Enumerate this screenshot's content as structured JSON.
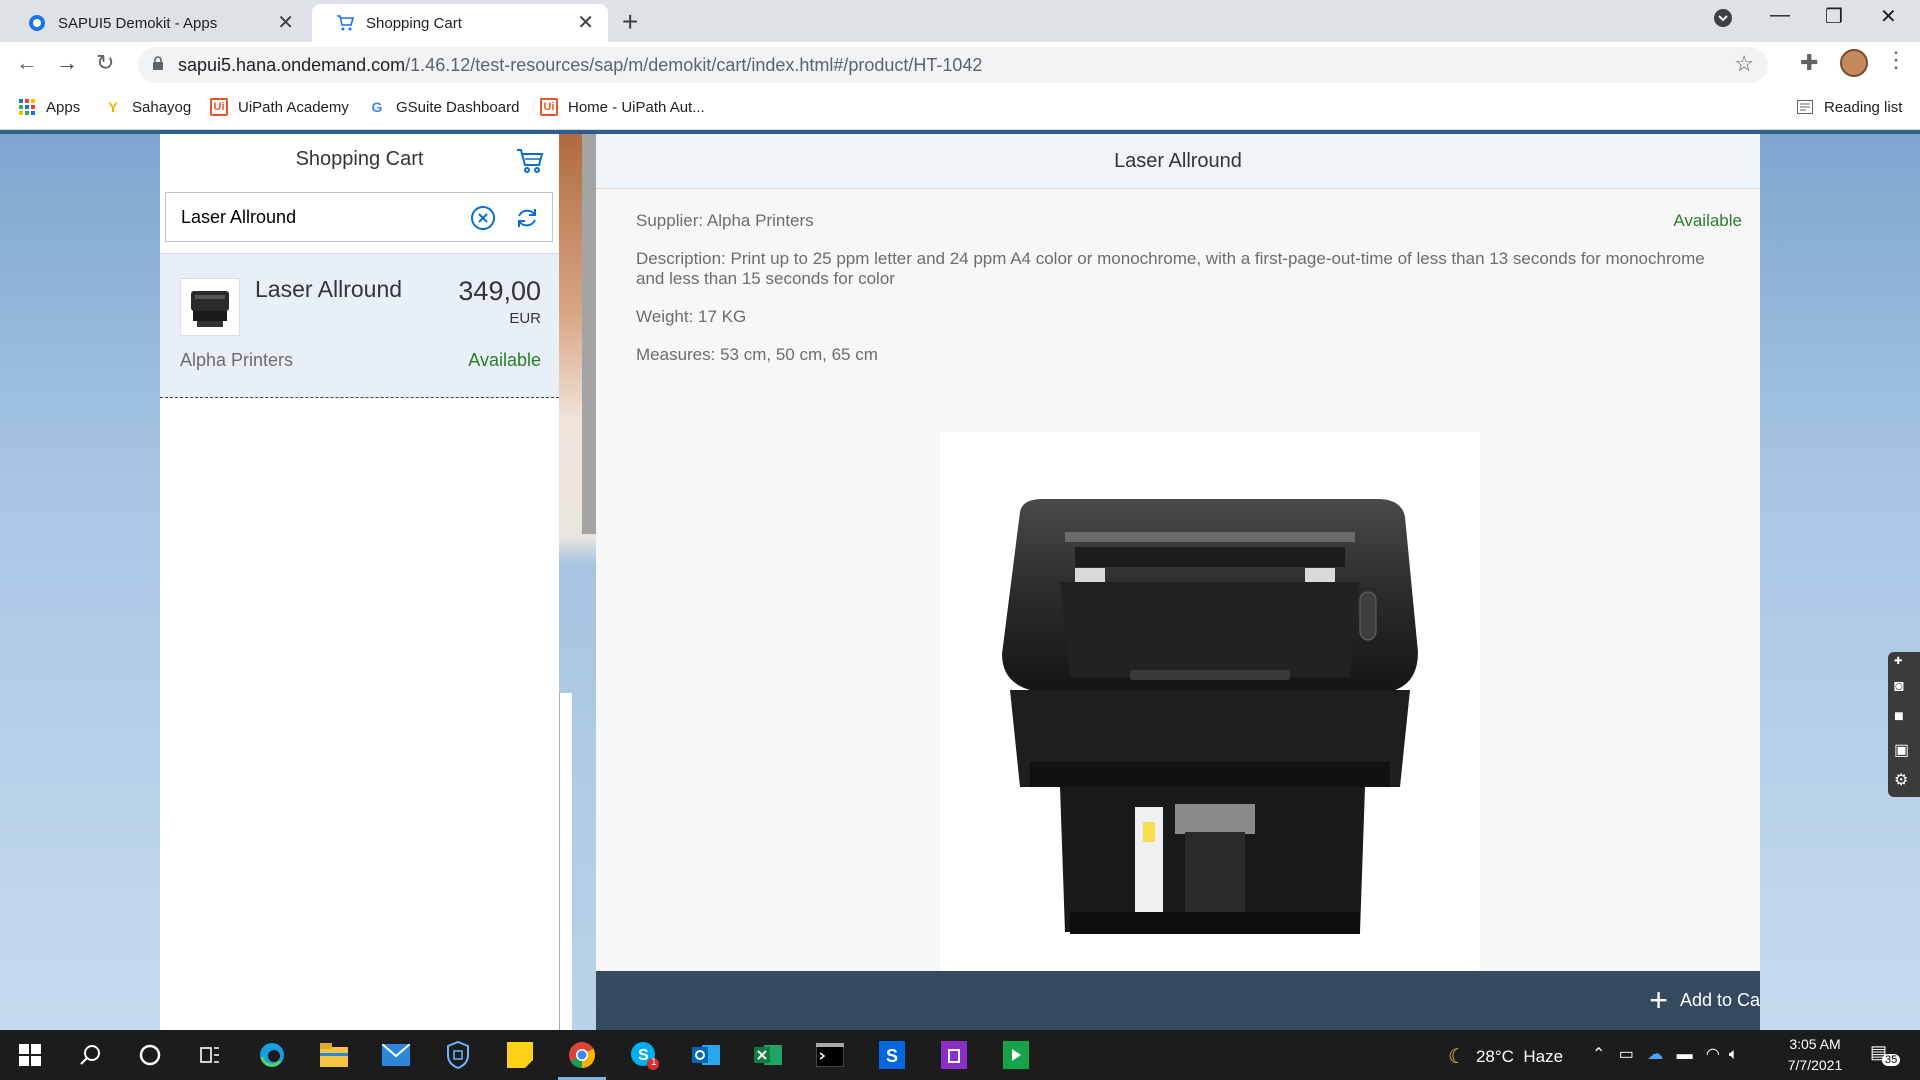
{
  "browser": {
    "tabs": [
      {
        "title": "SAPUI5 Demokit - Apps"
      },
      {
        "title": "Shopping Cart"
      }
    ],
    "url_host": "sapui5.hana.ondemand.com",
    "url_path": "/1.46.12/test-resources/sap/m/demokit/cart/index.html#/product/HT-1042",
    "bookmarks": [
      "Apps",
      "Sahayog",
      "UiPath Academy",
      "GSuite Dashboard",
      "Home - UiPath Aut..."
    ],
    "reading_list": "Reading list"
  },
  "master": {
    "title": "Shopping Cart",
    "search_value": "Laser Allround",
    "item": {
      "name": "Laser Allround",
      "price": "349,00",
      "currency": "EUR",
      "supplier": "Alpha Printers",
      "status": "Available"
    }
  },
  "detail": {
    "title": "Laser Allround",
    "supplier": "Supplier: Alpha Printers",
    "status": "Available",
    "description": "Description: Print up to 25 ppm letter and 24 ppm A4 color or monochrome, with a first-page-out-time of less than 13 seconds for monochrome and less than 15 seconds for color",
    "weight": "Weight: 17 KG",
    "measures": "Measures: 53 cm, 50 cm, 65 cm",
    "add_button": "Add to Ca"
  },
  "taskbar": {
    "weather_temp": "28°C",
    "weather_text": "Haze",
    "time": "3:05 AM",
    "date": "7/7/2021",
    "notification_count": "35",
    "skype_badge": "1"
  },
  "colors": {
    "available_green": "#2b7d2b",
    "footer_bg": "#354a5f",
    "selected_item_bg": "#e8eff6"
  }
}
